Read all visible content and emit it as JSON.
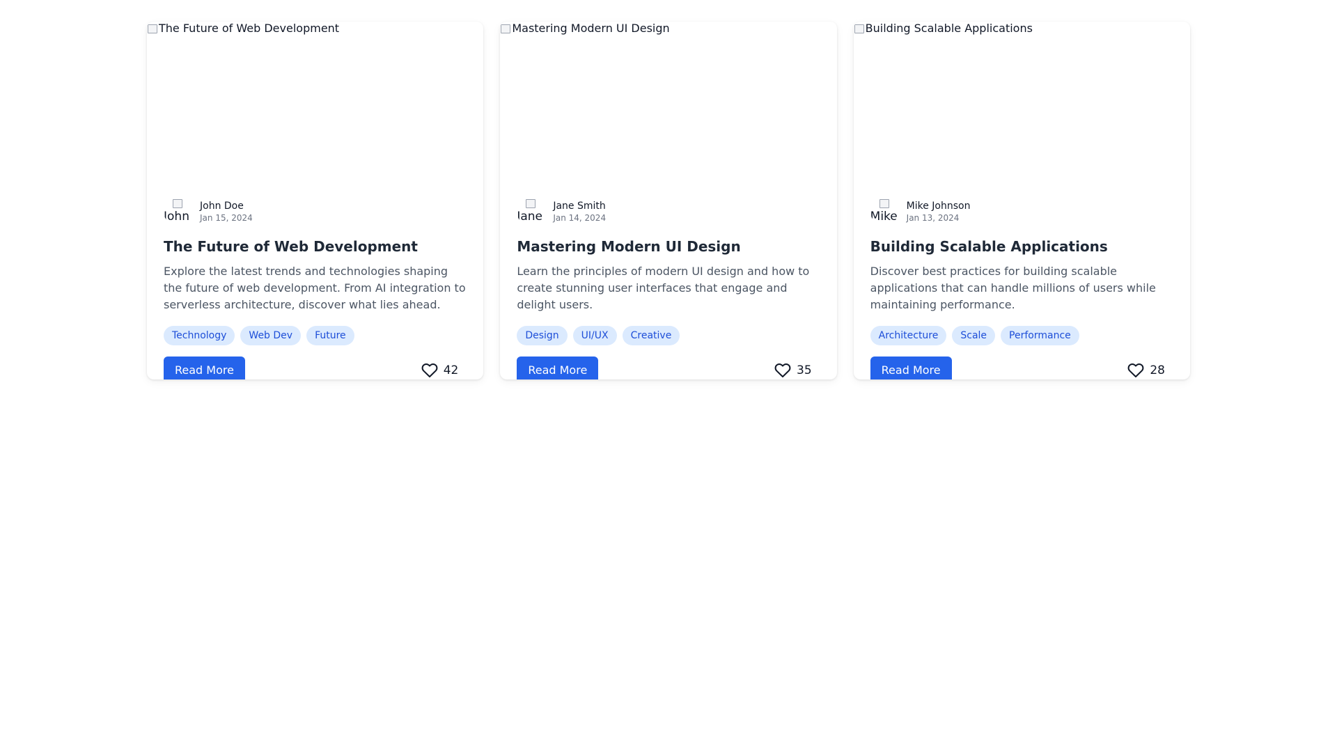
{
  "posts": [
    {
      "cover_alt": "The Future of Web Development",
      "author_alt": "John Doe",
      "author": "John Doe",
      "date": "Jan 15, 2024",
      "title": "The Future of Web Development",
      "description": "Explore the latest trends and technologies shaping the future of web development. From AI integration to serverless architecture, discover what lies ahead.",
      "tags": [
        "Technology",
        "Web Dev",
        "Future"
      ],
      "button_label": "Read More",
      "likes": "42"
    },
    {
      "cover_alt": "Mastering Modern UI Design",
      "author_alt": "Jane Smith",
      "author": "Jane Smith",
      "date": "Jan 14, 2024",
      "title": "Mastering Modern UI Design",
      "description": "Learn the principles of modern UI design and how to create stunning user interfaces that engage and delight users.",
      "tags": [
        "Design",
        "UI/UX",
        "Creative"
      ],
      "button_label": "Read More",
      "likes": "35"
    },
    {
      "cover_alt": "Building Scalable Applications",
      "author_alt": "Mike Johnson",
      "author": "Mike Johnson",
      "date": "Jan 13, 2024",
      "title": "Building Scalable Applications",
      "description": "Discover best practices for building scalable applications that can handle millions of users while maintaining performance.",
      "tags": [
        "Architecture",
        "Scale",
        "Performance"
      ],
      "button_label": "Read More",
      "likes": "28"
    }
  ],
  "icons": {
    "like": "heart-icon",
    "broken_image": "broken-image-icon"
  },
  "colors": {
    "accent": "#2563eb",
    "tag_bg": "#dbeafe",
    "tag_text": "#1d4ed8"
  }
}
